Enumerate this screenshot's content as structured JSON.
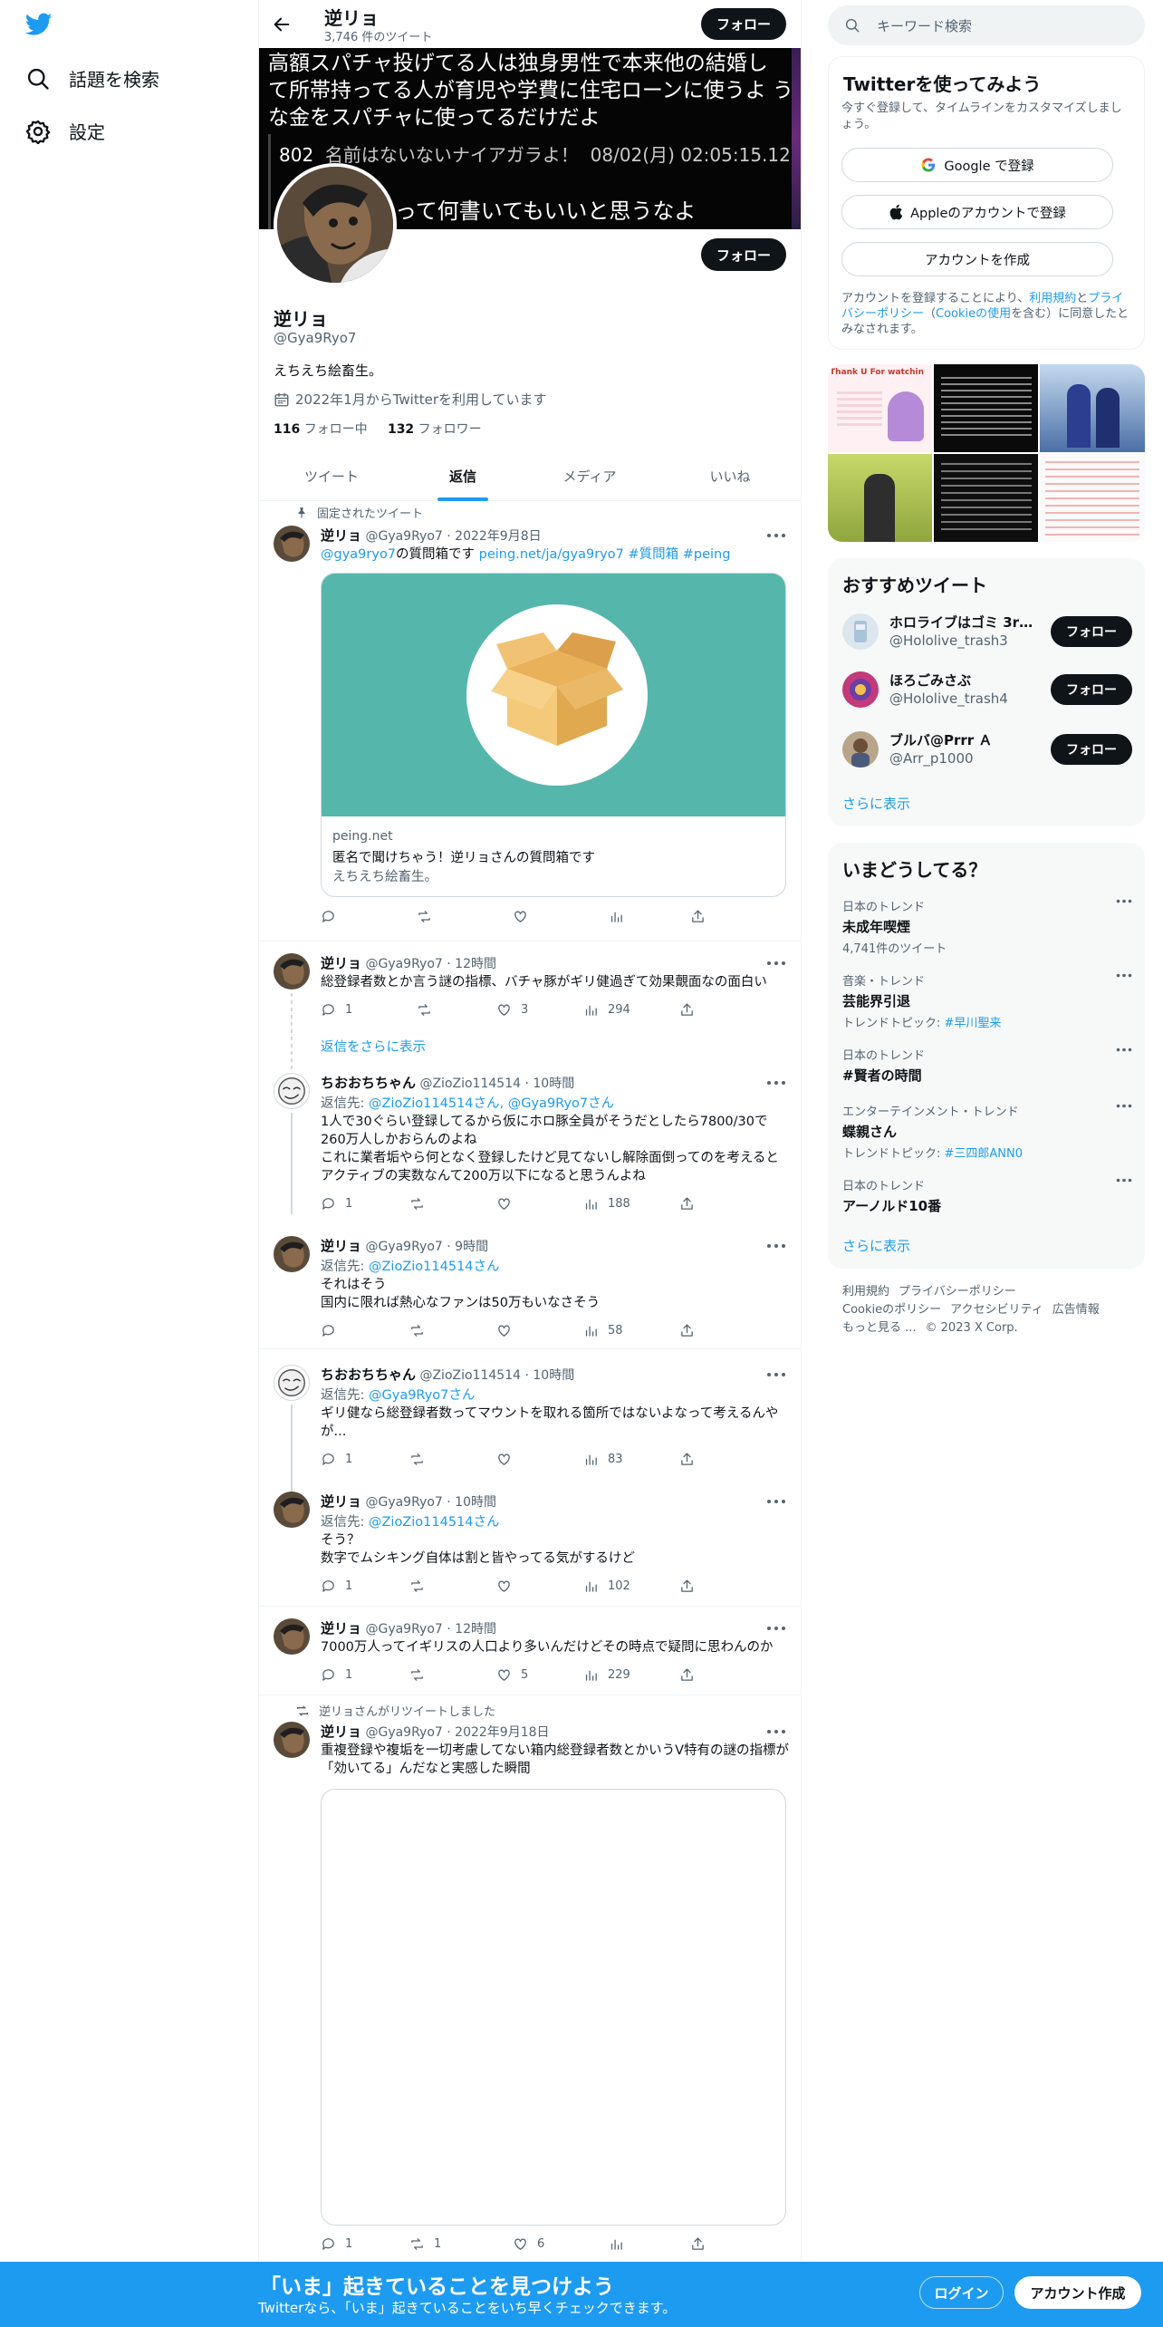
{
  "colors": {
    "brand": "#1d9bf0",
    "text": "#0f1419",
    "muted": "#536471"
  },
  "nav": {
    "explore": "話題を検索",
    "settings": "設定"
  },
  "header": {
    "name": "逆リョ",
    "tweet_count": "3,746 件のツイート",
    "follow": "フォロー"
  },
  "banner": {
    "text": "高額スパチャ投げてる人は独身男性で本来他の結婚し て所帯持ってる人が育児や学費に住宅ローンに使うよ うな金をスパチャに使ってるだけだよ",
    "meta_num": "802",
    "meta_name": "名前はないないナイアガラよ！",
    "meta_date": "08/02(月) 02:05:15.12",
    "sub": "って何書いてもいいと思うなよ"
  },
  "profile": {
    "follow": "フォロー",
    "name": "逆リョ",
    "handle": "@Gya9Ryo7",
    "bio": "えちえち絵畜生。",
    "joined": "2022年1月からTwitterを利用しています",
    "following_num": "116",
    "following_label": "フォロー中",
    "followers_num": "132",
    "followers_label": "フォロワー"
  },
  "tabs": [
    "ツイート",
    "返信",
    "メディア",
    "いいね"
  ],
  "pinned": {
    "label": "固定されたツイート",
    "name": "逆リョ",
    "handle": "@Gya9Ryo7",
    "time": "2022年9月8日",
    "mention": "@gya9ryo7",
    "text": "の質問箱です",
    "link": "peing.net/ja/gya9ryo7",
    "tags": "#質問箱 #peing",
    "card": {
      "domain": "peing.net",
      "title": "匿名で聞けちゃう！逆リョさんの質問箱です",
      "desc": "えちえち絵畜生。"
    }
  },
  "tweets": [
    {
      "name": "逆リョ",
      "handle": "@Gya9Ryo7",
      "time": "12時間",
      "text": "総登録者数とか言う謎の指標、バチャ豚がギリ健過ぎて効果覿面なの面白い",
      "replies": "1",
      "retweets": "",
      "likes": "3",
      "views": "294"
    },
    {
      "name": "ちおおちちゃん",
      "handle": "@ZioZio114514",
      "time": "10時間",
      "reply_prefix": "返信先:",
      "reply_to": "@ZioZio114514さん, @Gya9Ryo7さん",
      "text1": "1人で30ぐらい登録してるから仮にホロ豚全員がそうだとしたら7800/30で260万人しかおらんのよね",
      "text2": "これに業者垢やら何となく登録したけど見てないし解除面倒ってのを考えるとアクティブの実数なんて200万以下になると思うんよね",
      "replies": "1",
      "retweets": "",
      "likes": "",
      "views": "188"
    },
    {
      "name": "逆リョ",
      "handle": "@Gya9Ryo7",
      "time": "9時間",
      "reply_prefix": "返信先:",
      "reply_to": "@ZioZio114514さん",
      "text1": "それはそう",
      "text2": "国内に限れば熱心なファンは50万もいなさそう",
      "replies": "",
      "retweets": "",
      "likes": "",
      "views": "58"
    },
    {
      "name": "ちおおちちゃん",
      "handle": "@ZioZio114514",
      "time": "10時間",
      "reply_prefix": "返信先:",
      "reply_to": "@Gya9Ryo7さん",
      "text1": "ギリ健なら総登録者数ってマウントを取れる箇所ではないよなって考えるんやが...",
      "replies": "1",
      "retweets": "",
      "likes": "",
      "views": "83"
    },
    {
      "name": "逆リョ",
      "handle": "@Gya9Ryo7",
      "time": "10時間",
      "reply_prefix": "返信先:",
      "reply_to": "@ZioZio114514さん",
      "text1": "そう？",
      "text2": "数字でムシキング自体は割と皆やってる気がするけど",
      "replies": "1",
      "retweets": "",
      "likes": "",
      "views": "102"
    },
    {
      "name": "逆リョ",
      "handle": "@Gya9Ryo7",
      "time": "12時間",
      "text": "7000万人ってイギリスの人口より多いんだけどその時点で疑問に思わんのか",
      "replies": "1",
      "retweets": "",
      "likes": "5",
      "views": "229"
    },
    {
      "retweet_label": "逆リョさんがリツイートしました",
      "name": "逆リョ",
      "handle": "@Gya9Ryo7",
      "time": "2022年9月18日",
      "text": "重複登録や複垢を一切考慮してない箱内総登録者数とかいうV特有の謎の指標が「効いてる」んだなと実感した瞬間",
      "replies": "1",
      "retweets": "1",
      "likes": "6",
      "views": ""
    }
  ],
  "show_more_replies": "返信をさらに表示",
  "right": {
    "search_placeholder": "キーワード検索",
    "signup_title": "Twitterを使ってみよう",
    "signup_sub": "今すぐ登録して、タイムラインをカスタマイズしましょう。",
    "google": "Google で登録",
    "apple": "Appleのアカウントで登録",
    "create": "アカウントを作成",
    "terms_a": "アカウントを登録することにより、",
    "terms_link1": "利用規約",
    "terms_b": "と",
    "terms_link2": "プライバシーポリシー",
    "terms_c": "（",
    "terms_link3": "Cookieの使用",
    "terms_d": "を含む）に同意したとみなされます。",
    "media_thumb_text": "Thank U For watchin",
    "rec_title": "おすすめツイート",
    "recs": [
      {
        "name": "ホロライブはゴミ 3rd...",
        "handle": "@Hololive_trash3",
        "button": "フォロー"
      },
      {
        "name": "ほろごみさぶ",
        "handle": "@Hololive_trash4",
        "button": "フォロー"
      },
      {
        "name": "ブルバ@Prrr Ａ",
        "handle": "@Arr_p1000",
        "button": "フォロー"
      }
    ],
    "show_more": "さらに表示",
    "trends_title": "いまどうしてる？",
    "trends": [
      {
        "context": "日本のトレンド",
        "title": "未成年喫煙",
        "sub": "4,741件のツイート",
        "sub_link": ""
      },
      {
        "context": "音楽・トレンド",
        "title": "芸能界引退",
        "sub": "トレンドトピック: ",
        "sub_link": "#早川聖来"
      },
      {
        "context": "日本のトレンド",
        "title": "#賢者の時間",
        "sub": "",
        "sub_link": ""
      },
      {
        "context": "エンターテインメント・トレンド",
        "title": "蝶親さん",
        "sub": "トレンドトピック: ",
        "sub_link": "#三四郎ANN0"
      },
      {
        "context": "日本のトレンド",
        "title": "アーノルド10番",
        "sub": "",
        "sub_link": ""
      }
    ],
    "trends_more": "さらに表示",
    "footer": [
      "利用規約",
      "プライバシーポリシー",
      "Cookieのポリシー",
      "アクセシビリティ",
      "広告情報",
      "もっと見る ...",
      "© 2023 X Corp."
    ]
  },
  "bottom": {
    "title": "「いま」起きていることを見つけよう",
    "sub": "Twitterなら、「いま」起きていることをいち早くチェックできます。",
    "login": "ログイン",
    "signup": "アカウント作成"
  }
}
